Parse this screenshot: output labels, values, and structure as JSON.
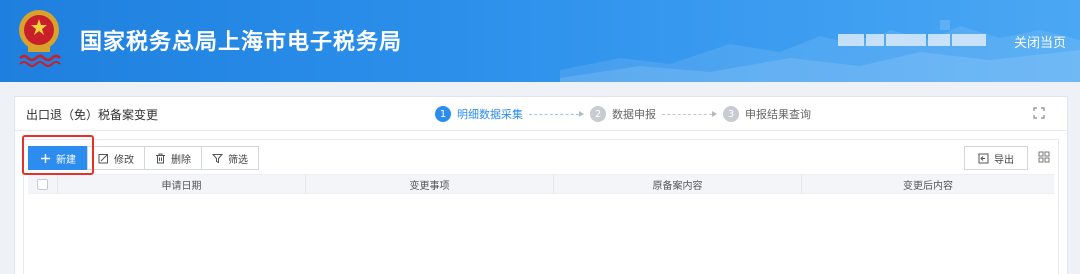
{
  "header": {
    "site_title": "国家税务总局上海市电子税务局",
    "close_page": "关闭当页",
    "accent": "#2b8fea"
  },
  "page": {
    "title": "出口退（免）税备案变更"
  },
  "steps": [
    {
      "num": "1",
      "label": "明细数据采集",
      "active": true
    },
    {
      "num": "2",
      "label": "数据申报",
      "active": false
    },
    {
      "num": "3",
      "label": "申报结果查询",
      "active": false
    }
  ],
  "toolbar": {
    "new_label": "新建",
    "edit_label": "修改",
    "delete_label": "删除",
    "filter_label": "筛选",
    "export_label": "导出"
  },
  "table": {
    "columns": [
      "申请日期",
      "变更事项",
      "原备案内容",
      "变更后内容"
    ]
  },
  "colors": {
    "primary": "#2d8cf0",
    "highlight": "#e8302a"
  }
}
